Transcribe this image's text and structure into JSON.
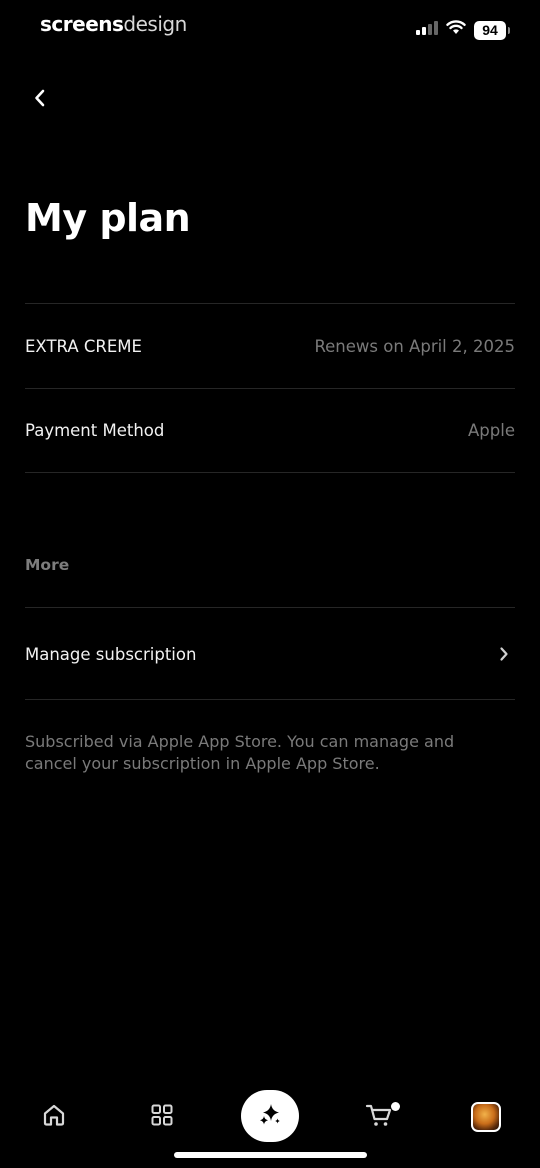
{
  "status_bar": {
    "brand_bold": "screens",
    "brand_thin": "design",
    "battery": "94"
  },
  "header": {
    "title": "My plan"
  },
  "plan": {
    "name": "EXTRA CREME",
    "renewal": "Renews on April 2, 2025"
  },
  "payment": {
    "label": "Payment Method",
    "value": "Apple"
  },
  "more": {
    "section_label": "More",
    "manage_label": "Manage subscription"
  },
  "footnote": "Subscribed via Apple App Store. You can manage and cancel your subscription in Apple App Store.",
  "tab_bar": {
    "icons": [
      "home-icon",
      "grid-icon",
      "sparkle-icon",
      "cart-icon",
      "avatar"
    ]
  },
  "colors": {
    "background": "#000000",
    "text_primary": "#f2f2f2",
    "text_secondary": "#7a7a7a",
    "divider": "#262626"
  }
}
